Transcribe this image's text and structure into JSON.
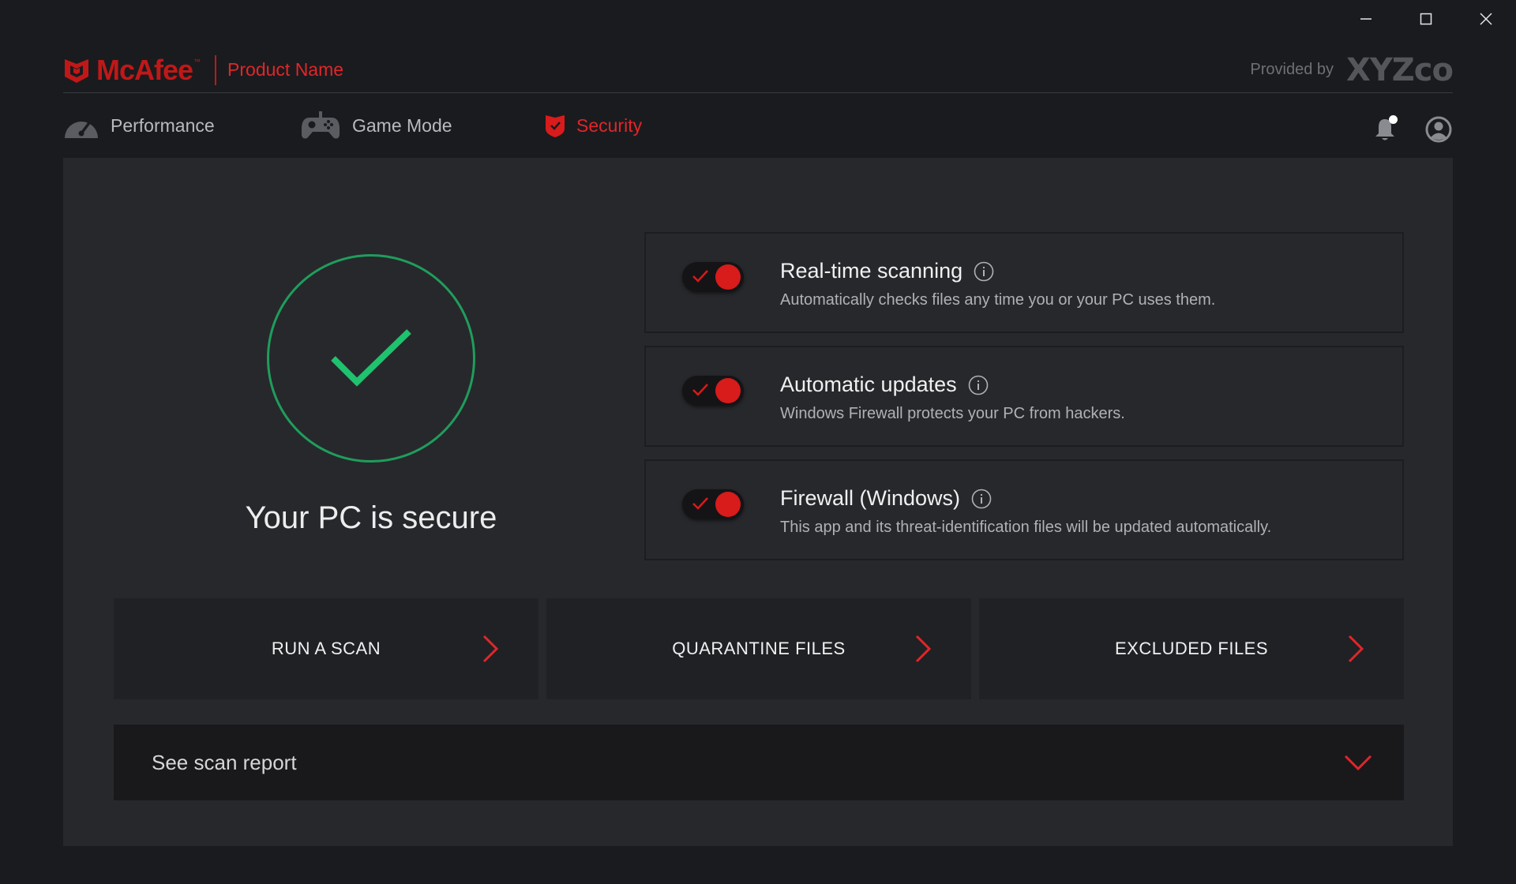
{
  "window": {
    "controls": [
      "minimize",
      "maximize",
      "close"
    ]
  },
  "header": {
    "brand": "McAfee",
    "trademark": "™",
    "product_name": "Product Name",
    "provided_by_label": "Provided by",
    "partner_name": "XYZco"
  },
  "nav": {
    "tabs": [
      {
        "label": "Performance",
        "icon": "speedometer-icon",
        "active": false
      },
      {
        "label": "Game Mode",
        "icon": "gamepad-icon",
        "active": false
      },
      {
        "label": "Security",
        "icon": "shield-check-icon",
        "active": true
      }
    ]
  },
  "top_icons": {
    "notifications": "bell-icon",
    "account": "user-circle-icon"
  },
  "status": {
    "text": "Your PC is secure",
    "icon": "checkmark-icon"
  },
  "features": [
    {
      "title": "Real-time scanning",
      "description": "Automatically checks files any time you or your PC uses them.",
      "enabled": true
    },
    {
      "title": "Automatic updates",
      "description": "Windows Firewall protects your PC from hackers.",
      "enabled": true
    },
    {
      "title": "Firewall (Windows)",
      "description": "This app and its threat-identification files will be updated automatically.",
      "enabled": true
    }
  ],
  "actions": [
    {
      "label": "RUN A SCAN"
    },
    {
      "label": "QUARANTINE FILES"
    },
    {
      "label": "EXCLUDED FILES"
    }
  ],
  "report": {
    "label": "See scan report"
  },
  "colors": {
    "accent": "#e0262a",
    "secure_green": "#1fc26e",
    "background": "#1a1b1e",
    "panel": "#27282c"
  }
}
